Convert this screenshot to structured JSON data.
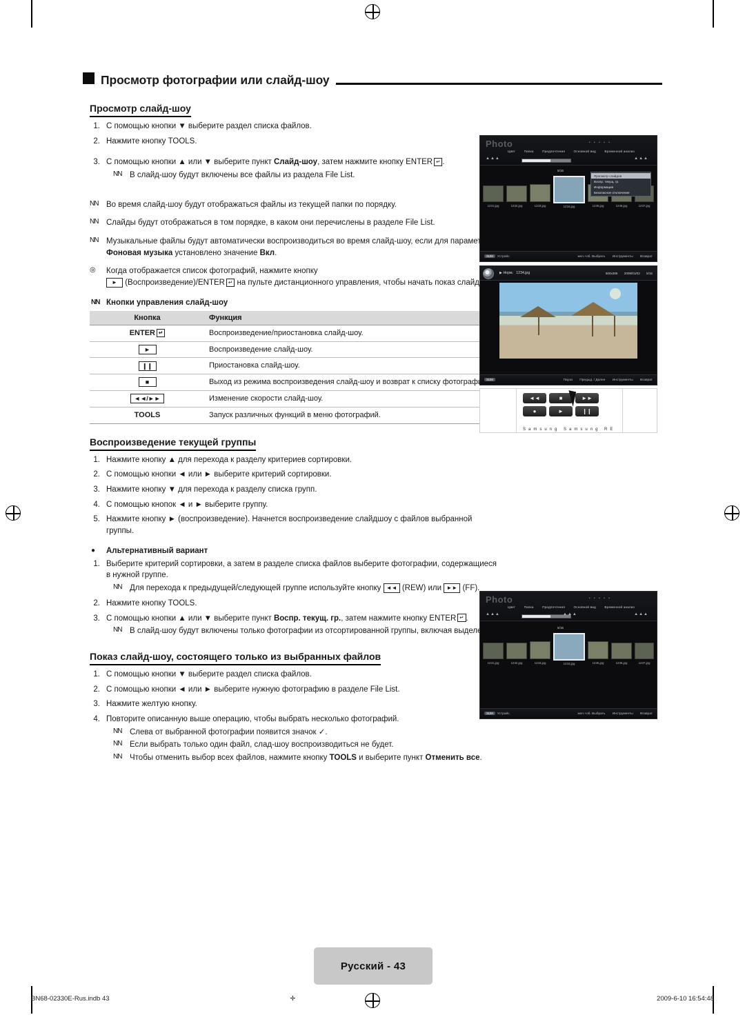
{
  "page": {
    "title": "Просмотр фотографии или слайд-шоу",
    "footer_left": "BN68-02330E-Rus.indb   43",
    "footer_right": "2009-6-10   16:54:48",
    "page_label": "Русский - 43"
  },
  "section1": {
    "heading": "Просмотр слайд-шоу",
    "steps": [
      {
        "num": "1.",
        "text": "С помощью кнопки ▼ выберите раздел списка файлов."
      },
      {
        "num": "2.",
        "text": "Нажмите кнопку TOOLS."
      }
    ],
    "step3": {
      "num": "3.",
      "text_a": "С помощью кнопки ▲ или ▼ выберите пункт ",
      "bold_a": "Слайд-шоу",
      "text_b": ", затем нажмите кнопку ENTER",
      "text_c": "."
    },
    "notes": [
      "В слайд-шоу будут включены все файлы из раздела File List.",
      "Во время слайд-шоу будут отображаться файлы из текущей папки по порядку.",
      "Слайды будут отображаться в том порядке, в каком они перечислены в разделе File List."
    ],
    "note_music": {
      "a": "Музыкальные файлы будут автоматически воспроизводиться во время слайд-шоу, если для параметра ",
      "bold": "Фоновая музыка",
      "b": " установлено значение ",
      "bold2": "Вкл",
      "c": "."
    },
    "note_play": {
      "a": "Когда отображается список фотографий, нажмите кнопку",
      "b": "(Воспроизведение)/ENTER",
      "c": " на пульте дистанционного управления, чтобы начать показ слайдов."
    },
    "keys_heading": "Кнопки управления слайд-шоу",
    "table": {
      "headers": [
        "Кнопка",
        "Функция"
      ],
      "rows": [
        {
          "key": "ENTER",
          "key_type": "enter",
          "fn": "Воспроизведение/приостановка слайд-шоу."
        },
        {
          "key": "►",
          "key_type": "box",
          "fn": "Воспроизведение слайд-шоу."
        },
        {
          "key": "❙❙",
          "key_type": "box",
          "fn": "Приостановка слайд-шоу."
        },
        {
          "key": "■",
          "key_type": "box",
          "fn": "Выход из режима воспроизведения слайд-шоу и возврат к списку фотографий."
        },
        {
          "key": "◄◄/►►",
          "key_type": "boxpair",
          "fn": "Изменение скорости слайд-шоу."
        },
        {
          "key": "TOOLS",
          "key_type": "plain",
          "fn": "Запуск различных функций в меню фотографий."
        }
      ]
    }
  },
  "section2": {
    "heading": "Воспроизведение текущей группы",
    "steps": [
      {
        "num": "1.",
        "text": "Нажмите кнопку ▲ для перехода к разделу критериев сортировки."
      },
      {
        "num": "2.",
        "text": "С помощью кнопки ◄ или ► выберите критерий сортировки."
      },
      {
        "num": "3.",
        "text": "Нажмите кнопку ▼ для перехода к разделу списка групп."
      },
      {
        "num": "4.",
        "text": "С помощью кнопок ◄ и ► выберите группу."
      },
      {
        "num": "5.",
        "text": "Нажмите кнопку ► (воспроизведение). Начнется воспроизведение слайдшоу с файлов выбранной группы."
      }
    ],
    "alt_heading": "Альтернативный вариант",
    "alt_steps": [
      {
        "num": "1.",
        "text": "Выберите критерий сортировки, а затем в разделе списка файлов выберите фотографии, содержащиеся в нужной группе."
      },
      {
        "num": "2.",
        "text": "Нажмите кнопку TOOLS."
      }
    ],
    "alt_note1": {
      "a": "Для перехода к предыдущей/следующей группе используйте кнопку ",
      "b": " (REW) или ",
      "c": " (FF)."
    },
    "alt_step3": {
      "num": "3.",
      "a": "С помощью кнопки ▲ или ▼ выберите пункт ",
      "bold": "Воспр. текущ. гр.",
      "b": ", затем нажмите кнопку ENTER",
      "c": "."
    },
    "alt_note2": "В слайд-шоу будут включены только фотографии из отсортированной группы, включая выделенные файлы."
  },
  "section3": {
    "heading": "Показ слайд-шоу, состоящего только из выбранных файлов",
    "steps": [
      {
        "num": "1.",
        "text": "С помощью кнопки ▼ выберите раздел списка файлов."
      },
      {
        "num": "2.",
        "text": "С помощью кнопки ◄ или ► выберите нужную фотографию в разделе File List."
      },
      {
        "num": "3.",
        "text": "Нажмите желтую кнопку."
      },
      {
        "num": "4.",
        "text": "Повторите описанную выше операцию, чтобы выбрать несколько фотографий."
      }
    ],
    "notes": [
      "Слева от выбранной фотографии появится значок ✓.",
      "Если выбрать только один файл, слад-шоу воспроизводиться не будет."
    ],
    "note_cancel": {
      "a": "Чтобы отменить выбор всех файлов, нажмите кнопку ",
      "bold": "TOOLS",
      "b": " и выберите пункт ",
      "bold2": "Отменить все",
      "c": "."
    }
  },
  "screens": {
    "file_list": {
      "logo": "Photo",
      "menu": [
        "Цвет",
        "Папка",
        "Предпочтения",
        "Основной вид",
        "Временной анализ"
      ],
      "thumb_captions": [
        "1231.jpg",
        "1232.jpg",
        "1233.jpg",
        "1234.jpg",
        "1235.jpg",
        "1236.jpg",
        "1237.jpg"
      ],
      "counter": "5/15",
      "popup_items": [
        "Просмотр слайдов",
        "Воспр. текущ. гр.",
        "Информация",
        "Безопасное отключение"
      ],
      "footer_left_chip": "SUM",
      "footer_left_text": "Устройс.",
      "footer_items": [
        "жел.+об. Выбрать",
        "Инструменты",
        "Возврат"
      ]
    },
    "viewer": {
      "mode": "Норм.",
      "filename": "1234.jpg",
      "resolution": "500x365",
      "date": "2009/01/02",
      "counter": "5/15",
      "footer_left_chip": "SUM",
      "footer_items": [
        "Пауза",
        "Предыд. / Далее",
        "Инструменты",
        "Возврат"
      ]
    },
    "remote": {
      "buttons": [
        "◄◄",
        "■",
        "►►",
        "●",
        "►",
        "❙❙"
      ],
      "caption": "Samsung  Samsung  RE"
    },
    "group_list": {
      "logo": "Photo",
      "menu": [
        "Цвет",
        "Папка",
        "Предпочтения",
        "Основной вид",
        "Временной анализ"
      ],
      "thumb_captions": [
        "1231.jpg",
        "1232.jpg",
        "1233.jpg",
        "1234.jpg",
        "1235.jpg",
        "1236.jpg",
        "1237.jpg"
      ],
      "counter": "5/15",
      "footer_left_chip": "SUM",
      "footer_left_text": "Устройс.",
      "footer_items": [
        "жел.+об. Выбрать",
        "Инструменты",
        "Возврат"
      ]
    }
  }
}
